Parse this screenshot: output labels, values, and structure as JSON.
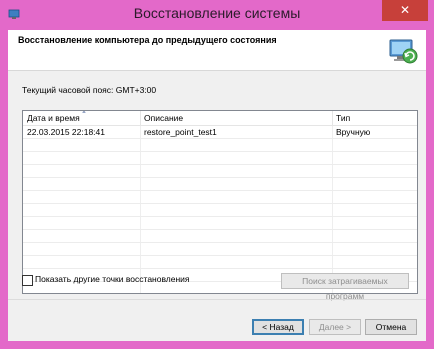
{
  "window": {
    "title": "Восстановление системы",
    "close_glyph": "✕",
    "titlebar_color": "#e369c9",
    "close_color": "#c7403a"
  },
  "header": {
    "heading": "Восстановление компьютера до предыдущего состояния",
    "icon": "system-restore-icon"
  },
  "timezone_label": "Текущий часовой пояс: GMT+3:00",
  "table": {
    "columns": [
      "Дата и время",
      "Описание",
      "Тип"
    ],
    "rows": [
      {
        "date": "22.03.2015 22:18:41",
        "description": "restore_point_test1",
        "type": "Вручную"
      }
    ]
  },
  "show_more": {
    "label": "Показать другие точки восстановления",
    "checked": false
  },
  "buttons": {
    "affected": "Поиск затрагиваемых программ",
    "back": "< Назад",
    "next": "Далее >",
    "cancel": "Отмена"
  }
}
